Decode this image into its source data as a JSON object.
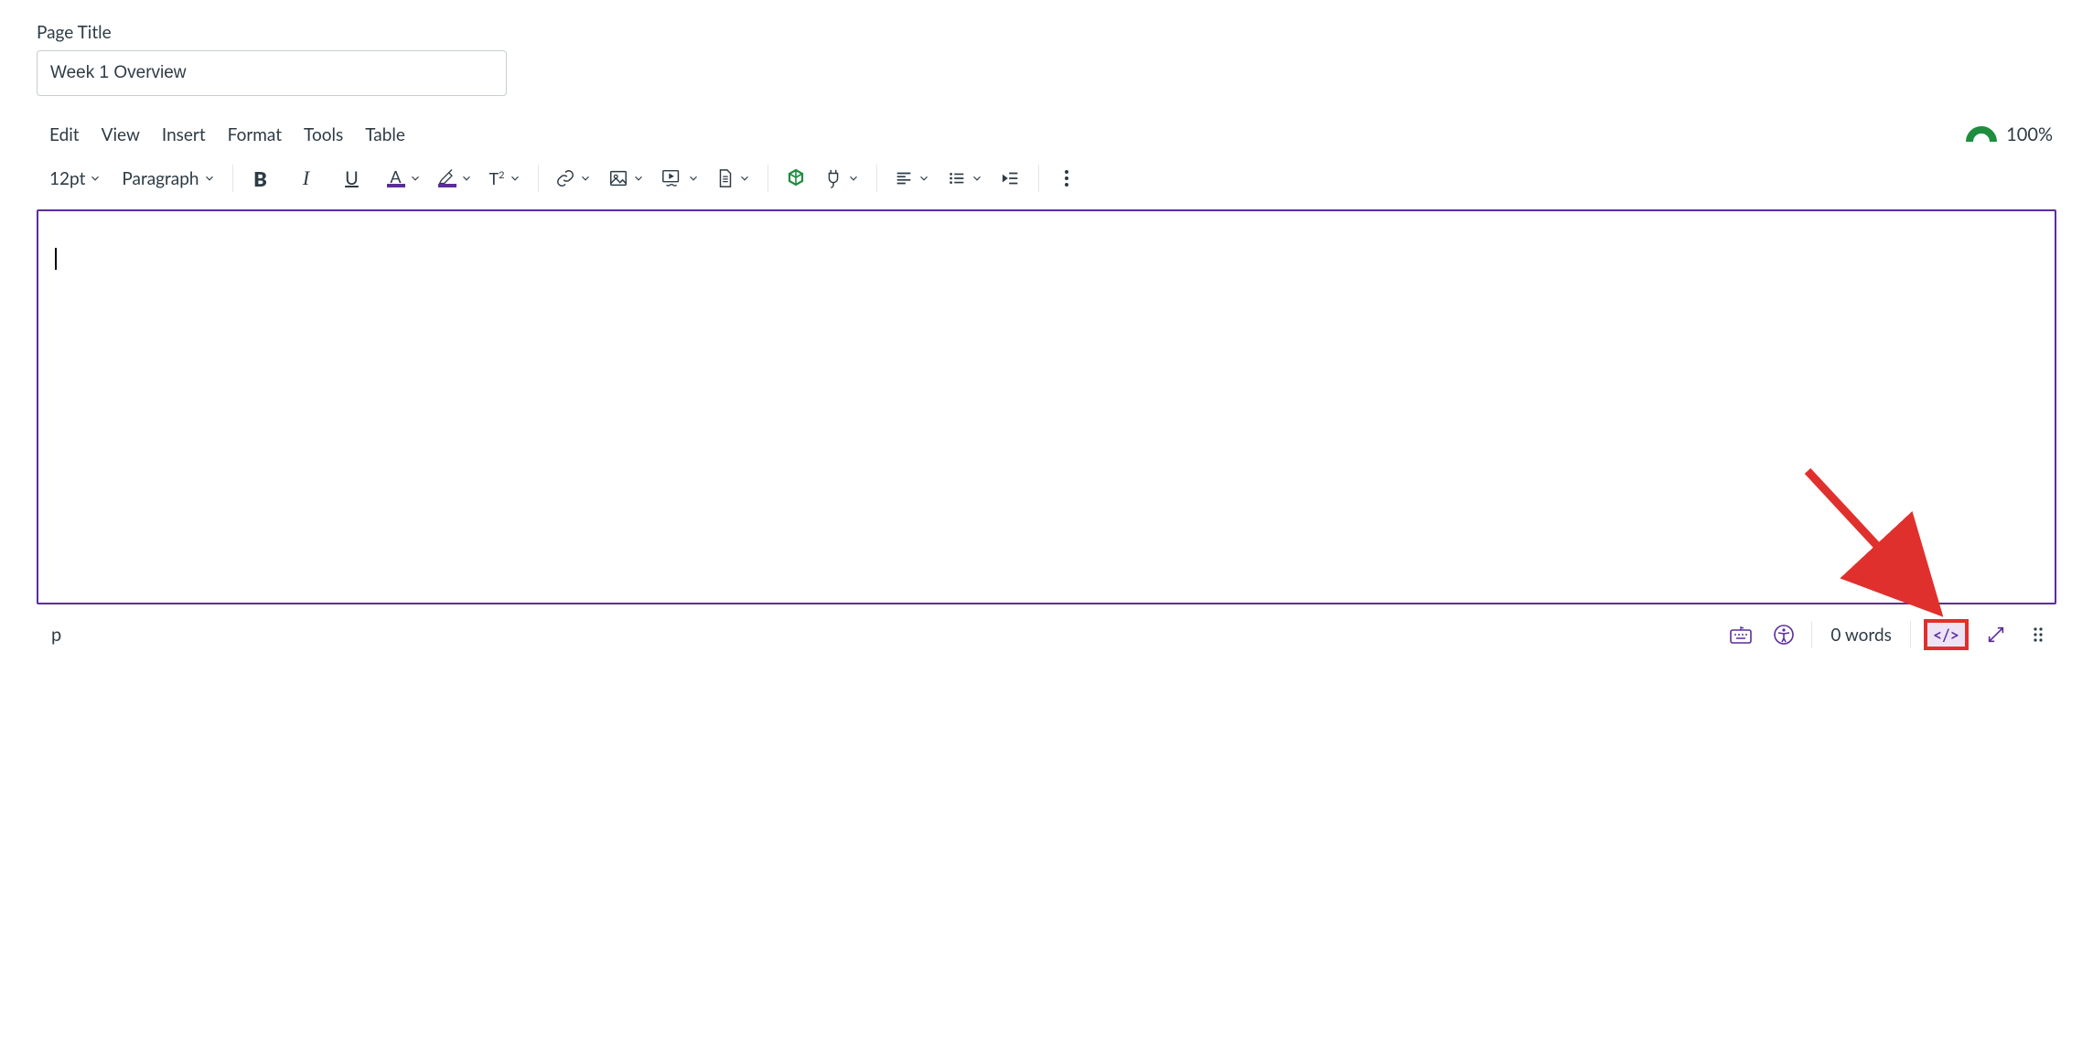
{
  "page_title_label": "Page Title",
  "page_title_value": "Week 1 Overview",
  "menubar": {
    "edit": "Edit",
    "view": "View",
    "insert": "Insert",
    "format": "Format",
    "tools": "Tools",
    "table": "Table"
  },
  "score": "100%",
  "toolbar": {
    "font_size": "12pt",
    "block_format": "Paragraph",
    "text_color": "#5b2d9b",
    "highlight_color": "#5b2d9b"
  },
  "statusbar": {
    "element_path": "p",
    "word_count": "0 words",
    "html_label": "</>"
  },
  "accent": "#5b2d9b"
}
